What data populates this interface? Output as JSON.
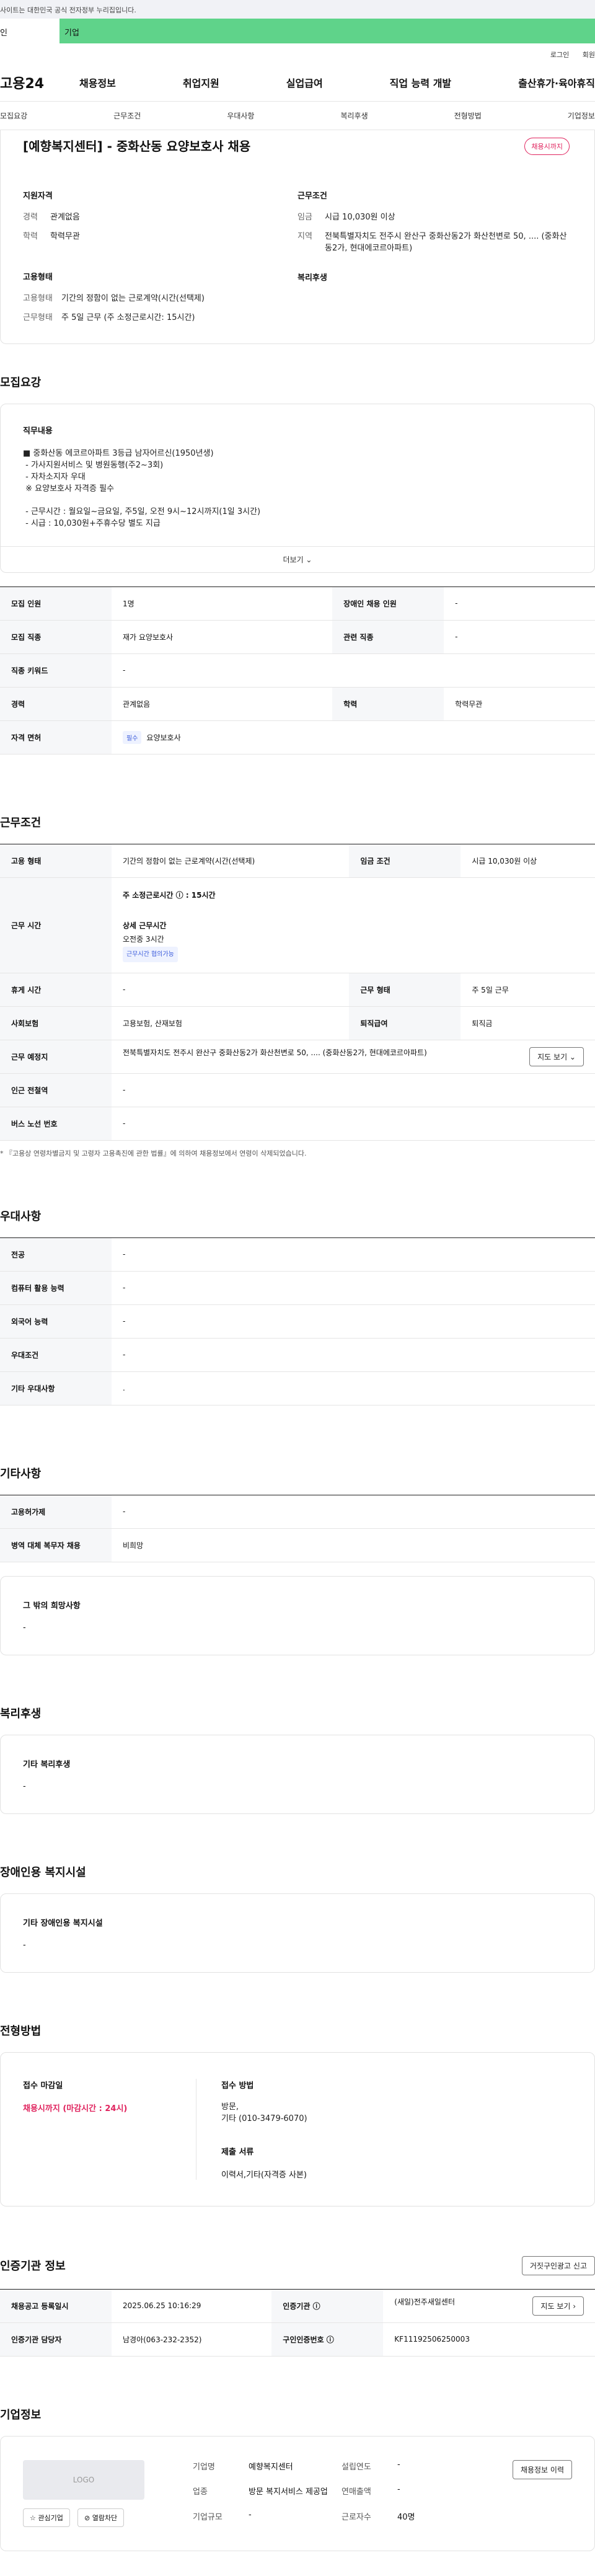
{
  "gov_banner": "사이트는 대한민국 공식 전자정부 누리집입니다.",
  "tabs": {
    "individual": "인",
    "business": "기업"
  },
  "util": {
    "login": "로그인",
    "join": "회원"
  },
  "logo": "고용24",
  "gnb": [
    "채용정보",
    "취업지원",
    "실업급여",
    "직업 능력 개발",
    "출산휴가·육아휴직"
  ],
  "subnav": [
    "모집요강",
    "근무조건",
    "우대사항",
    "복리후생",
    "전형방법",
    "기업정보"
  ],
  "job": {
    "title": "[예향복지센터] - 중화산동 요양보호사 채용",
    "badge": "채용시까지",
    "qual_heading": "지원자격",
    "cond_heading": "근무조건",
    "career_k": "경력",
    "career_v": "관계없음",
    "edu_k": "학력",
    "edu_v": "학력무관",
    "wage_k": "임금",
    "wage_v": "시급 10,030원 이상",
    "region_k": "지역",
    "region_v": "전북특별자치도 전주시 완산구 중화산동2가 화산천변로 50, .... (중화산동2가, 현대에코르아파트)",
    "emp_heading": "고용형태",
    "welfare_heading": "복리후생",
    "emptype_k": "고용형태",
    "emptype_v": "기간의 정함이 없는 근로계약(시간(선택제)",
    "worktype_k": "근무형태",
    "worktype_v": "주 5일 근무 (주 소정근로시간: 15시간)"
  },
  "recruit": {
    "section_title": "모집요강",
    "duty_heading": "직무내용",
    "duty_text": "■ 중화산동 에코르아파트 3등급 남자어르신(1950년생)\n - 가사지원서비스 및 병원동행(주2~3회)\n - 자차소지자 우대\n ※ 요양보호사 자격증 필수\n\n - 근무시간 : 월요일~금요일, 주5일, 오전 9시~12시까지(1일 3시간)\n - 시급 : 10,030원+주휴수당 별도 지급",
    "more": "더보기 ⌄",
    "rows": {
      "headcount_k": "모집 인원",
      "headcount_v": "1명",
      "disabled_k": "장애인 채용 인원",
      "disabled_v": "-",
      "job_k": "모집 직종",
      "job_v": "재가 요양보호사",
      "related_k": "관련 직종",
      "related_v": "-",
      "keyword_k": "직종 키워드",
      "keyword_v": "-",
      "career_k": "경력",
      "career_v": "관계없음",
      "edu_k": "학력",
      "edu_v": "학력무관",
      "license_k": "자격 면허",
      "license_tag": "필수",
      "license_v": "요양보호사"
    }
  },
  "work": {
    "section_title": "근무조건",
    "emptype_k": "고용 형태",
    "emptype_v": "기간의 정함이 없는 근로계약(시간(선택제)",
    "wage_k": "임금 조건",
    "wage_v": "시급 10,030원 이상",
    "hours_k": "근무 시간",
    "hours_main": "주 소정근로시간 ⓘ : 15시간",
    "hours_detail_k": "상세 근무시간",
    "hours_detail_v": "오전중 3시간",
    "hours_tag": "근무시간 협의가능",
    "break_k": "휴게 시간",
    "break_v": "-",
    "form_k": "근무 형태",
    "form_v": "주 5일 근무",
    "insurance_k": "사회보험",
    "insurance_v": "고용보험, 산재보험",
    "severance_k": "퇴직급여",
    "severance_v": "퇴직금",
    "location_k": "근무 예정지",
    "location_v": "전북특별자치도 전주시 완산구 중화산동2가 화산천변로 50, .... (중화산동2가, 현대에코르아파트)",
    "map_btn": "지도 보기 ⌄",
    "subway_k": "인근 전철역",
    "subway_v": "-",
    "bus_k": "버스 노선 번호",
    "bus_v": "-",
    "note": "* 『고용상 연령차별금지 및 고령자 고용촉진에 관한 법률』에 의하여 채용정보에서 연령이 삭제되었습니다."
  },
  "pref": {
    "section_title": "우대사항",
    "major_k": "전공",
    "major_v": "-",
    "computer_k": "컴퓨터 활용 능력",
    "computer_v": "-",
    "lang_k": "외국어 능력",
    "lang_v": "-",
    "cond_k": "우대조건",
    "cond_v": "-",
    "etc_k": "기타 우대사항",
    "etc_v": "."
  },
  "other": {
    "section_title": "기타사항",
    "support_k": "고용허가제",
    "support_v": "-",
    "military_k": "병역 대체 복무자 채용",
    "military_v": "비희망",
    "wish_heading": "그 밖의 희망사항",
    "wish_v": "-"
  },
  "welfare": {
    "section_title": "복리후생",
    "heading": "기타 복리후생",
    "value": "-"
  },
  "facility": {
    "section_title": "장애인용 복지시설",
    "heading": "기타 장애인용 복지시설",
    "value": "-"
  },
  "apply": {
    "section_title": "전형방법",
    "deadline_h": "접수 마감일",
    "deadline_v": "채용시까지 (마감시간 : 24시)",
    "method_h": "접수 방법",
    "method_v": "방문,\n기타 (010-3479-6070)",
    "docs_h": "제출 서류",
    "docs_v": "이력서,기타(자격증 사본)"
  },
  "agency": {
    "section_title": "인증기관 정보",
    "report_btn": "거짓구인광고 신고",
    "reg_k": "채용공고 등록일시",
    "reg_v": "2025.06.25 10:16:29",
    "agency_k": "인증기관 ⓘ",
    "agency_v": "(새일)전주새일센터",
    "map_btn": "지도 보기 ›",
    "manager_k": "인증기관 담당자",
    "manager_v": "남경아(063-232-2352)",
    "num_k": "구인인증번호 ⓘ",
    "num_v": "KF11192506250003"
  },
  "company": {
    "section_title": "기업정보",
    "logo_text": "LOGO",
    "fav_btn": "☆ 관심기업",
    "block_btn": "⊘ 열람차단",
    "name_k": "기업명",
    "name_v": "예향복지센터",
    "year_k": "설립연도",
    "year_v": "-",
    "industry_k": "업종",
    "industry_v": "방문 복지서비스 제공업",
    "sales_k": "연매출액",
    "sales_v": "-",
    "size_k": "기업규모",
    "size_v": "-",
    "staff_k": "근로자수",
    "staff_v": "40명",
    "history_btn": "채용정보 이력"
  }
}
